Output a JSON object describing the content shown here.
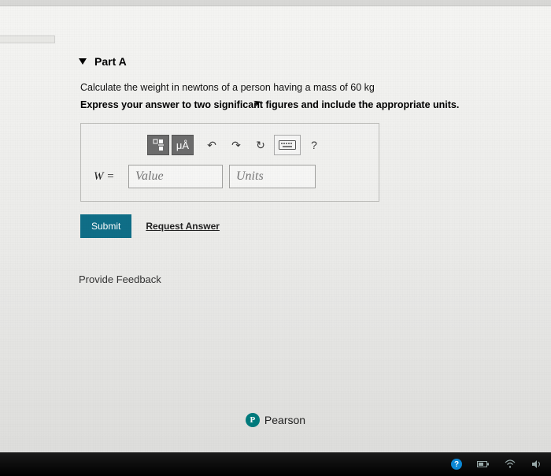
{
  "part": {
    "title": "Part A",
    "question": "Calculate the weight in newtons of a person having a mass of 60 kg",
    "instructions": "Express your answer to two significant figures and include the appropriate units."
  },
  "toolbar": {
    "fraction_label": "□/□",
    "mu_label": "μÅ",
    "undo_label": "↶",
    "redo_label": "↷",
    "reset_label": "↻",
    "keyboard_label": "⌨",
    "help_label": "?"
  },
  "answer": {
    "variable_label": "W =",
    "value_placeholder": "Value",
    "units_placeholder": "Units"
  },
  "actions": {
    "submit_label": "Submit",
    "request_label": "Request Answer"
  },
  "feedback_label": "Provide Feedback",
  "brand": {
    "badge": "P",
    "name": "Pearson"
  },
  "tb": {
    "help": "?"
  }
}
